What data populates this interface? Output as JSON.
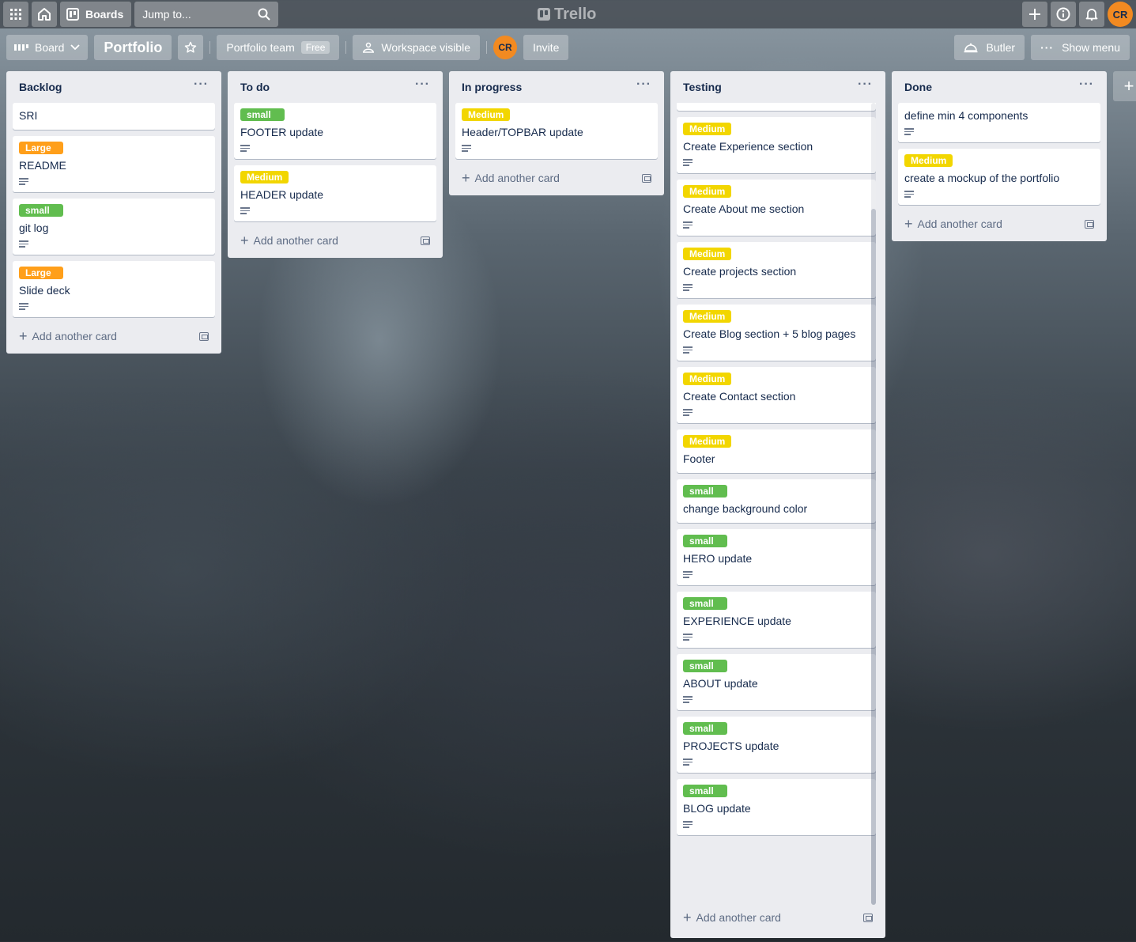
{
  "header": {
    "boards_label": "Boards",
    "search_placeholder": "Jump to...",
    "logo_text": "Trello",
    "avatar_initials": "CR"
  },
  "boardbar": {
    "view_label": "Board",
    "board_title": "Portfolio",
    "team_label": "Portfolio team",
    "team_badge": "Free",
    "visibility_label": "Workspace visible",
    "member_initials": "CR",
    "invite_label": "Invite",
    "butler_label": "Butler",
    "menu_label": "Show menu"
  },
  "lists": [
    {
      "title": "Backlog",
      "add_label": "Add another card",
      "cards": [
        {
          "label": "",
          "label_color": "",
          "title": "SRI",
          "has_desc": false
        },
        {
          "label": "Large",
          "label_color": "orange",
          "title": "README",
          "has_desc": true
        },
        {
          "label": "small",
          "label_color": "green",
          "title": "git log",
          "has_desc": true
        },
        {
          "label": "Large",
          "label_color": "orange",
          "title": "Slide deck",
          "has_desc": true
        }
      ]
    },
    {
      "title": "To do",
      "add_label": "Add another card",
      "cards": [
        {
          "label": "small",
          "label_color": "green",
          "title": "FOOTER update",
          "has_desc": true
        },
        {
          "label": "Medium",
          "label_color": "yellow",
          "title": "HEADER update",
          "has_desc": true
        }
      ]
    },
    {
      "title": "In progress",
      "add_label": "Add another card",
      "cards": [
        {
          "label": "Medium",
          "label_color": "yellow",
          "title": "Header/TOPBAR update",
          "has_desc": true
        }
      ]
    },
    {
      "title": "Testing",
      "add_label": "Add another card",
      "cards": [
        {
          "label": "Medium",
          "label_color": "yellow",
          "title": "Create Experience section",
          "has_desc": true
        },
        {
          "label": "Medium",
          "label_color": "yellow",
          "title": "Create About me section",
          "has_desc": true
        },
        {
          "label": "Medium",
          "label_color": "yellow",
          "title": "Create projects section",
          "has_desc": true
        },
        {
          "label": "Medium",
          "label_color": "yellow",
          "title": "Create Blog section + 5 blog pages",
          "has_desc": true
        },
        {
          "label": "Medium",
          "label_color": "yellow",
          "title": "Create Contact section",
          "has_desc": true
        },
        {
          "label": "Medium",
          "label_color": "yellow",
          "title": "Footer",
          "has_desc": false
        },
        {
          "label": "small",
          "label_color": "green",
          "title": "change background color",
          "has_desc": false
        },
        {
          "label": "small",
          "label_color": "green",
          "title": "HERO update",
          "has_desc": true
        },
        {
          "label": "small",
          "label_color": "green",
          "title": "EXPERIENCE update",
          "has_desc": true
        },
        {
          "label": "small",
          "label_color": "green",
          "title": "ABOUT update",
          "has_desc": true
        },
        {
          "label": "small",
          "label_color": "green",
          "title": "PROJECTS update",
          "has_desc": true
        },
        {
          "label": "small",
          "label_color": "green",
          "title": "BLOG update",
          "has_desc": true
        }
      ]
    },
    {
      "title": "Done",
      "add_label": "Add another card",
      "cards": [
        {
          "label": "",
          "label_color": "",
          "title": "define min 4 components",
          "has_desc": true
        },
        {
          "label": "Medium",
          "label_color": "yellow",
          "title": "create a mockup of the portfolio",
          "has_desc": true
        }
      ]
    }
  ],
  "colors": {
    "green": "#61bd4f",
    "yellow": "#f2d600",
    "orange": "#ff9f1a",
    "avatar": "#f28a21"
  }
}
